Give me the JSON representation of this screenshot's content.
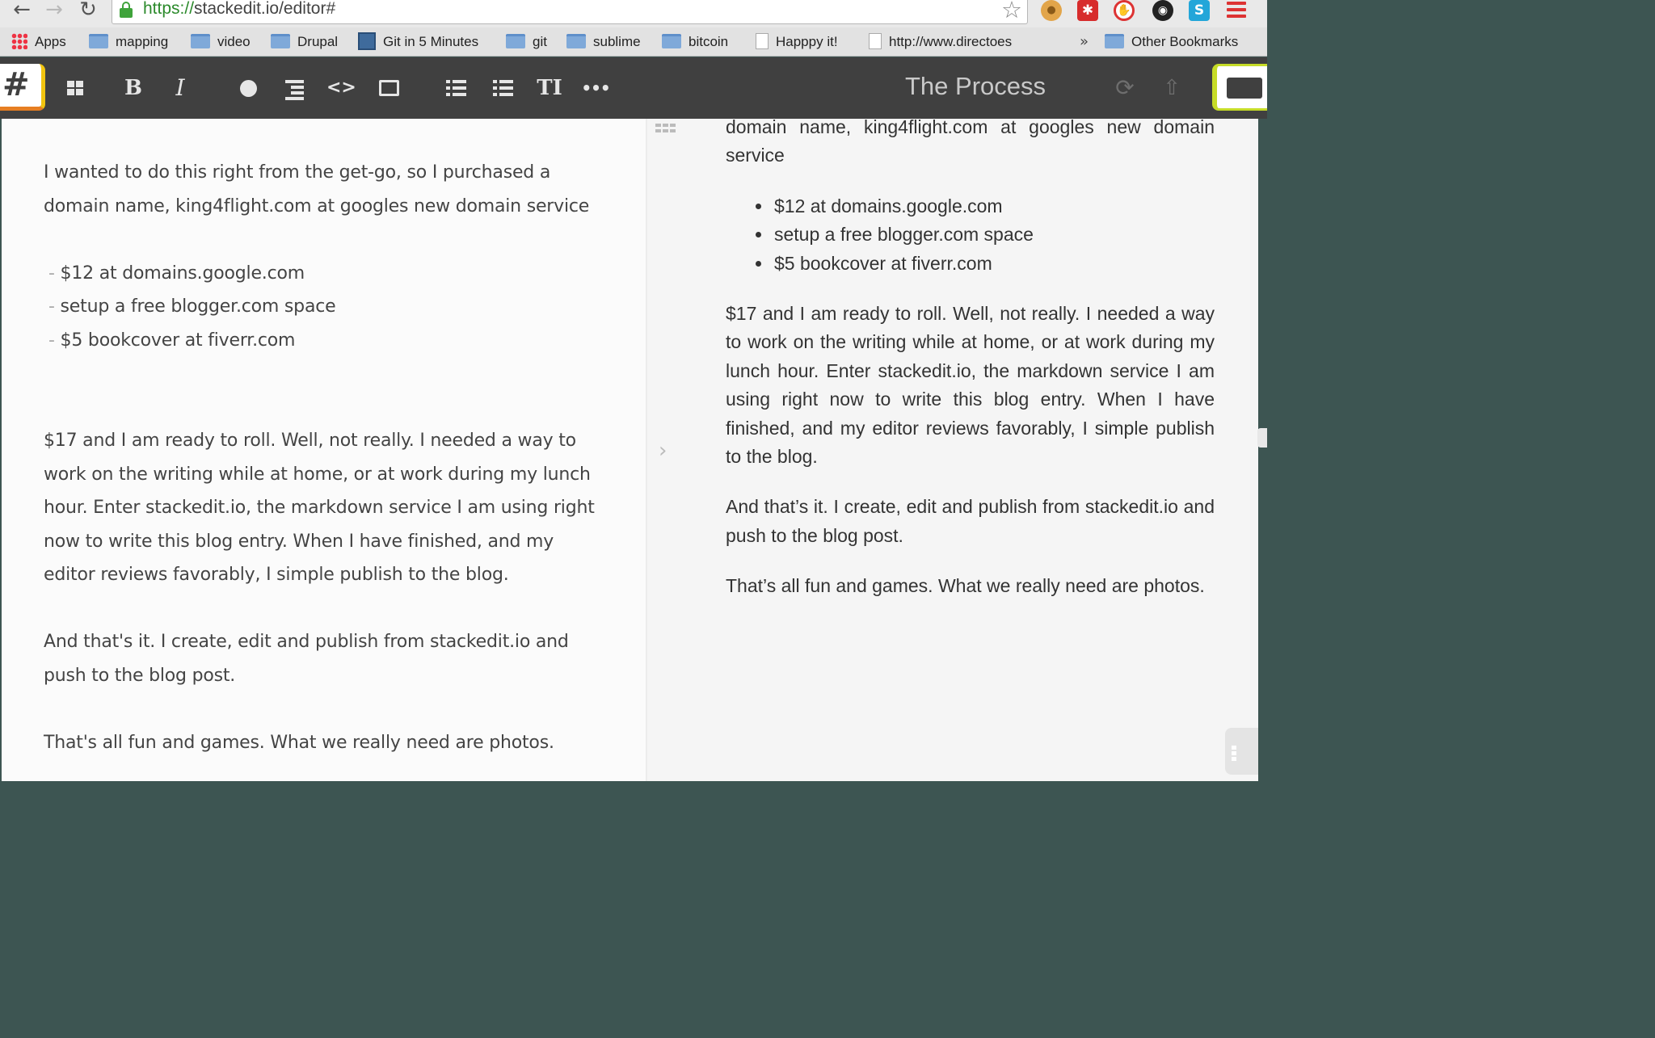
{
  "browser": {
    "url_scheme": "https://",
    "url_rest": "stackedit.io/editor#",
    "bookmarks": [
      {
        "label": "Apps",
        "icon": "apps-icon"
      },
      {
        "label": "mapping",
        "icon": "folder-icon"
      },
      {
        "label": "video",
        "icon": "folder-icon"
      },
      {
        "label": "Drupal",
        "icon": "folder-icon"
      },
      {
        "label": "Git in 5 Minutes",
        "icon": "git-icon"
      },
      {
        "label": "git",
        "icon": "folder-icon"
      },
      {
        "label": "sublime",
        "icon": "folder-icon"
      },
      {
        "label": "bitcoin",
        "icon": "folder-icon"
      },
      {
        "label": "Happpy it!",
        "icon": "page-icon"
      },
      {
        "label": "http://www.directoes",
        "icon": "page-icon"
      }
    ],
    "overflow": "»",
    "other_bookmarks": "Other Bookmarks"
  },
  "toolbar": {
    "document_title": "The Process",
    "hash": "#",
    "bold": "B",
    "italic": "I",
    "code": "<>",
    "heading": "TI",
    "more": "•••"
  },
  "editor": {
    "lines": [
      "I wanted to do this right from the get-go, so I purchased a",
      "domain name, king4flight.com at googles new domain service"
    ],
    "bullets": [
      "$12 at domains.google.com",
      "setup a free blogger.com space",
      "$5 bookcover at fiverr.com"
    ],
    "bullet_marker": "-",
    "para2": [
      "$17 and I am ready to roll. Well, not really. I needed a way to",
      "work on the writing while at home, or at work during my lunch",
      "hour. Enter stackedit.io, the markdown service I am using right",
      "now to write this blog entry. When I have finished, and my",
      "editor reviews favorably, I simple publish to the blog."
    ],
    "para3": [
      "And that's it. I create, edit and publish from stackedit.io and",
      "push to the blog post."
    ],
    "para4": [
      "That's all fun and games. What we really need are photos."
    ]
  },
  "preview": {
    "intro": "domain name, king4flight.com at googles new domain service",
    "bullets": [
      "$12 at domains.google.com",
      "setup a free blogger.com space",
      "$5 bookcover at fiverr.com"
    ],
    "para2": "$17 and I am ready to roll. Well, not really. I needed a way to work on the writing while at home, or at work during my lunch hour. Enter stackedit.io, the markdown service I am using right now to write this blog entry. When I have finished, and my editor reviews favorably, I simple publish to the blog.",
    "para3": "And that’s it. I create, edit and publish from stackedit.io and push to the blog post.",
    "para4": "That’s all fun and games. What we really need are photos.",
    "chevron": "›"
  },
  "colors": {
    "toolbar_bg": "#404040",
    "url_secure": "#2b8a2b",
    "hash_accent": "#f1c40f",
    "folder_accent": "#c6dc27"
  }
}
